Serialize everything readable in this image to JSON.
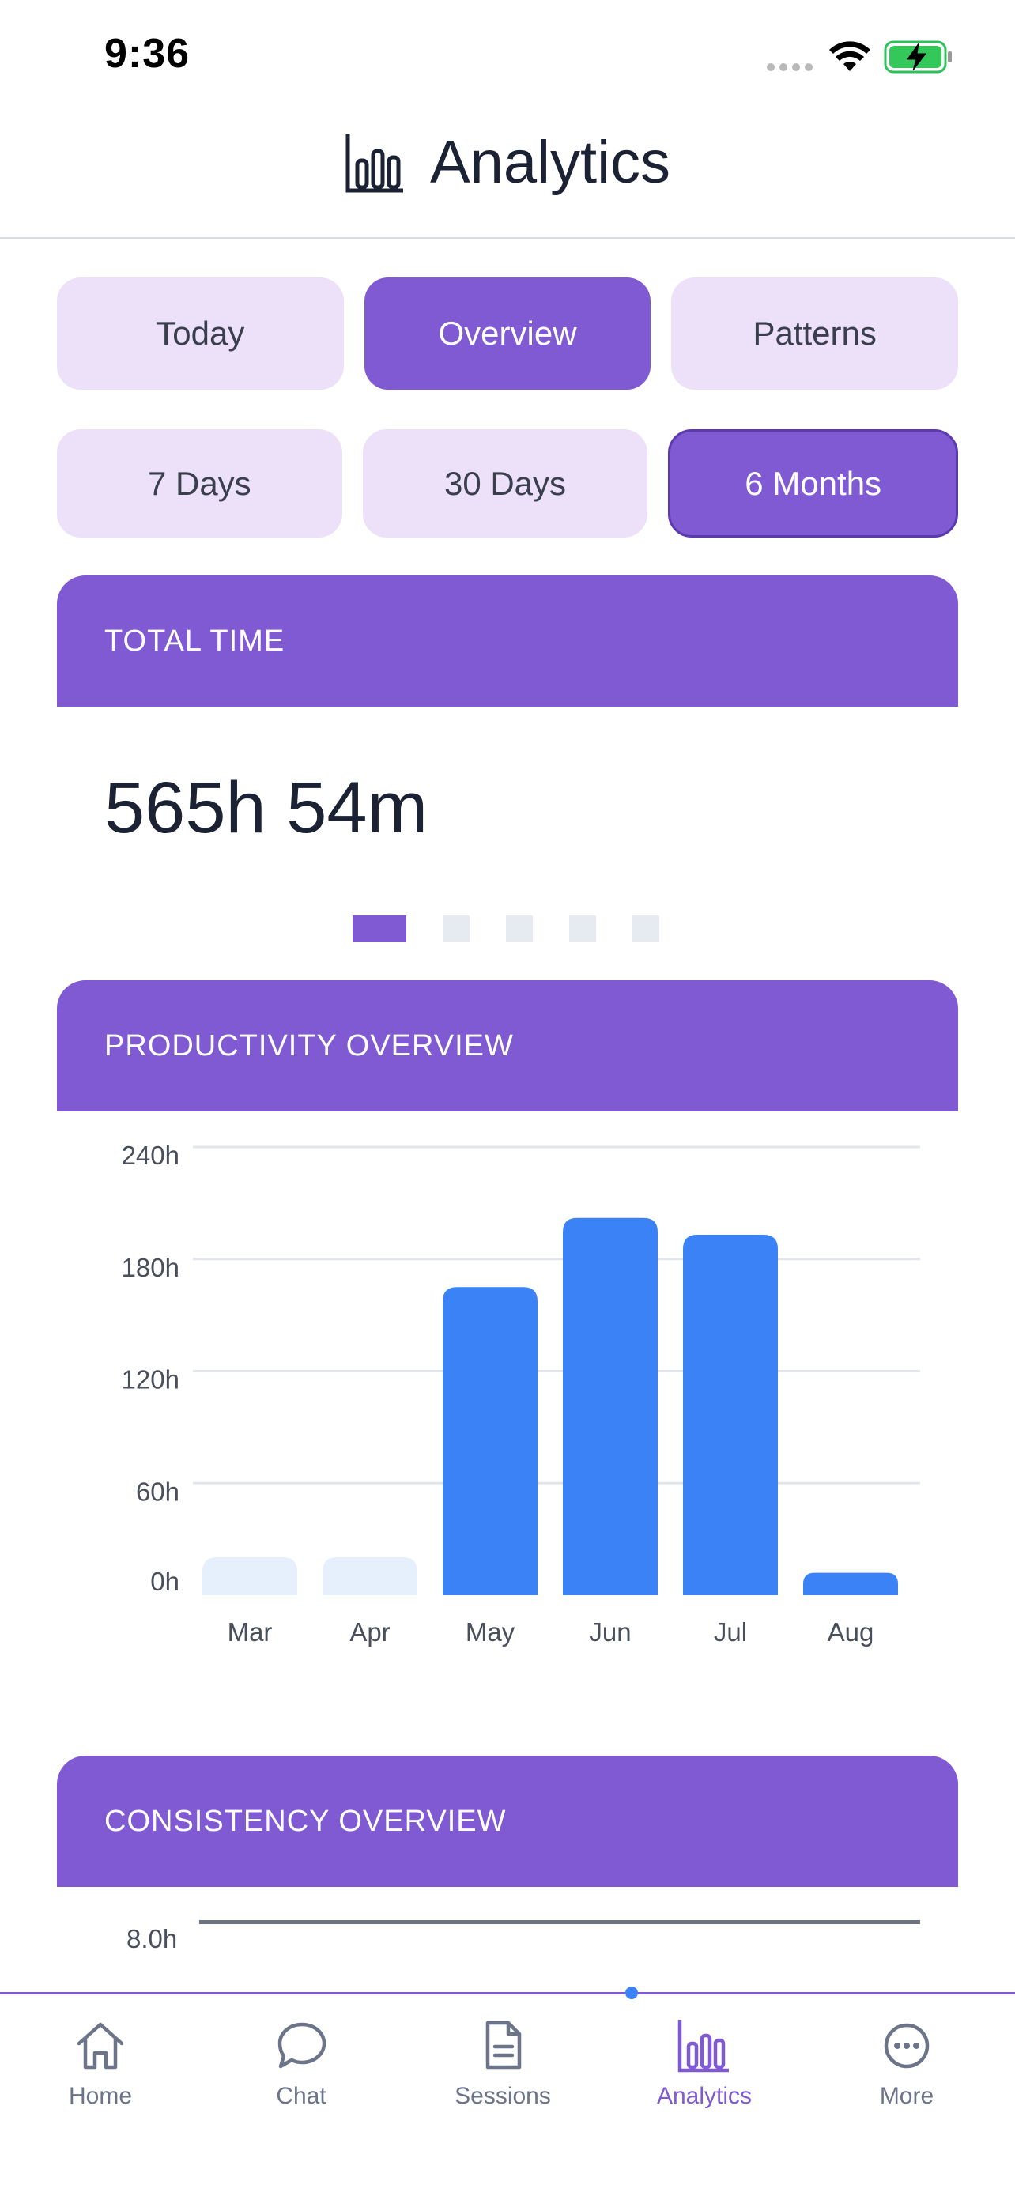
{
  "status_bar": {
    "time": "9:36"
  },
  "header": {
    "title": "Analytics",
    "icon": "bar-chart-icon"
  },
  "view_tabs": [
    {
      "label": "Today",
      "active": false
    },
    {
      "label": "Overview",
      "active": true
    },
    {
      "label": "Patterns",
      "active": false
    }
  ],
  "range_tabs": [
    {
      "label": "7 Days",
      "active": false
    },
    {
      "label": "30 Days",
      "active": false
    },
    {
      "label": "6 Months",
      "active": true
    }
  ],
  "total_time": {
    "heading": "TOTAL TIME",
    "value": "565h 54m"
  },
  "pager": {
    "count": 5,
    "active_index": 0
  },
  "productivity": {
    "heading": "PRODUCTIVITY OVERVIEW"
  },
  "chart_data": {
    "type": "bar",
    "categories": [
      "Mar",
      "Apr",
      "May",
      "Jun",
      "Jul",
      "Aug"
    ],
    "values": [
      0,
      0,
      165,
      202,
      193,
      12
    ],
    "placeholder": [
      true,
      true,
      false,
      false,
      false,
      false
    ],
    "ylim": [
      0,
      240
    ],
    "yticks": [
      0,
      60,
      120,
      180,
      240
    ],
    "ytick_labels": [
      "0h",
      "60h",
      "120h",
      "180h",
      "240h"
    ],
    "grid": true,
    "colors": {
      "bar": "#3b82f6",
      "placeholder_bar": "#e6effc",
      "grid": "#e2e5ec"
    }
  },
  "consistency": {
    "heading": "CONSISTENCY OVERVIEW",
    "y_label": "8.0h"
  },
  "tab_bar": {
    "items": [
      {
        "label": "Home",
        "icon": "home-icon",
        "active": false
      },
      {
        "label": "Chat",
        "icon": "chat-bubble-icon",
        "active": false
      },
      {
        "label": "Sessions",
        "icon": "document-icon",
        "active": false
      },
      {
        "label": "Analytics",
        "icon": "bar-chart-icon",
        "active": true
      },
      {
        "label": "More",
        "icon": "more-circle-icon",
        "active": false
      }
    ]
  },
  "colors": {
    "accent": "#7f5ad3",
    "accent_light": "#ede0f9",
    "bar_blue": "#3b82f6"
  }
}
